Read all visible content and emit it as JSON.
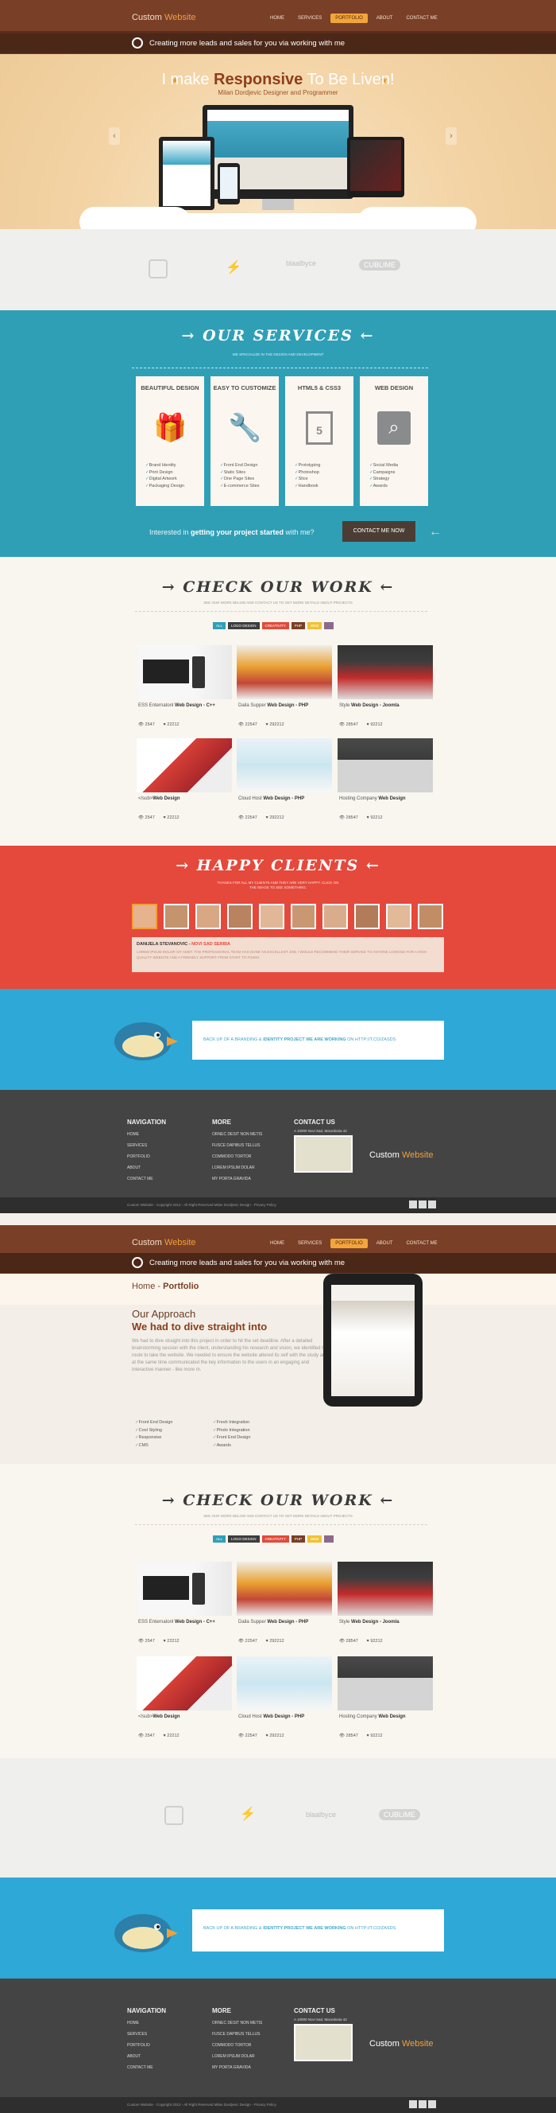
{
  "brand": {
    "name": "Custom ",
    "highlight": "Website"
  },
  "nav": [
    "HOME",
    "SERVICES",
    "PORTFOLIO",
    "ABOUT",
    "CONTACT ME"
  ],
  "strip": {
    "text": "Creating more leads and sales for you via working with me"
  },
  "hero": {
    "headline_pre": "I make ",
    "headline_bold": "Responsive",
    "headline_post": " To Be Liven!",
    "sub": "Milan Dordjevic Designer and Programmer"
  },
  "clients": [
    "blaalbyce",
    "CUBLIME"
  ],
  "services": {
    "title": "OUR SERVICES",
    "subtitle": "WE SPECIALIZE IN THE DESIGN AND DEVELOPMENT",
    "cards": [
      {
        "title": "BEAUTIFUL DESIGN",
        "icon": "gift-icon",
        "items": [
          "Brand Identity",
          "Print Design",
          "Digital Artwork",
          "Packaging Design"
        ]
      },
      {
        "title": "EASY TO CUSTOMIZE",
        "icon": "wrench-icon",
        "items": [
          "Front End Design",
          "Static Sites",
          "One Page Sites",
          "E-commerce Sites"
        ]
      },
      {
        "title": "HTML5 & CSS3",
        "icon": "html5-icon",
        "items": [
          "Prototyping",
          "Photoshop",
          "Slice",
          "Handbook"
        ]
      },
      {
        "title": "WEB DESIGN",
        "icon": "search-icon",
        "items": [
          "Social Media",
          "Campaigns",
          "Strategy",
          "Awards"
        ]
      }
    ],
    "cta_pre": "Interested in ",
    "cta_bold": "getting your project started",
    "cta_post": " with me?",
    "cta_btn": "CONTACT ME NOW"
  },
  "work": {
    "title": "CHECK OUR WORK",
    "subtitle": "SEE OUR WORK BELOW AND CONTACT US TO GET MORE DETAILS ABOUT PROJECTS",
    "filters": [
      "ALL",
      "LOGO DESIGN",
      "CREATIVITY",
      "PHP",
      "WEB"
    ],
    "items": [
      {
        "pre": "ESS Enternatonl ",
        "bold": "Web Design - C++",
        "views": "2547",
        "likes": "22212"
      },
      {
        "pre": "Daila Supper ",
        "bold": "Web Design - PHP",
        "views": "22547",
        "likes": "292212"
      },
      {
        "pre": "Style ",
        "bold": "Web Design - Joomla",
        "views": "28547",
        "likes": "92212"
      },
      {
        "pre": "</sub>",
        "bold": "Web Design",
        "views": "2547",
        "likes": "22212"
      },
      {
        "pre": "Cloud Host ",
        "bold": "Web Design - PHP",
        "views": "22547",
        "likes": "292212"
      },
      {
        "pre": "Hosting Company ",
        "bold": "Web Design",
        "views": "28547",
        "likes": "92212"
      }
    ]
  },
  "happy": {
    "title": "HAPPY CLIENTS",
    "subtitle": "THANKS FOR ALL MY CLIENTS AND THEY ARE VERY HAPPY. CLICK ON THE IMAGE TO SEE SOMETHING.",
    "quote_name": "DANIJELA STEVANOVIC",
    "quote_role": "NOVI SAD SERBIA",
    "quote_text": "LOREM IPSUM DOLOR SIT AMET. THE PROFESSIONAL TEAM HAS DONE AN EXCELLENT JOB. I WOULD RECOMMEND THEIR SERVICE TO ANYONE LOOKING FOR A HIGH QUALITY WEBSITE AND A FRIENDLY SUPPORT FROM START TO FINISH."
  },
  "bird": {
    "text_pre": "BACK UP OF A BRANDING & ",
    "text_bold": "IDENTITY PROJECT WE ARE WORKING",
    "text_post": " ON HTTP://T.CO/ZASDS"
  },
  "footer": {
    "nav_title": "NAVIGATION",
    "nav": [
      "HOME",
      "SERVICES",
      "PORTFOLIO",
      "ABOUT",
      "CONTACT ME"
    ],
    "more_title": "MORE",
    "more": [
      "ORNEC DESIT NON METIS",
      "FUSCE DAPIBUS TELLUS",
      "COMMODO TORTOR",
      "LOREM IPSUM DOLAR",
      "MY PORTA GRAVIDA"
    ],
    "contact_title": "CONTACT US",
    "address": "A 10000 Novi Sad, Macedonia 42",
    "copyright": "Custom Website - Copyright 2013 - All Right Reserved Milan Dordjevic Design - Privacy Policy"
  },
  "page2": {
    "breadcrumb_home": "Home",
    "breadcrumb_sep": " - ",
    "breadcrumb_current": "Portfolio",
    "approach_title": "Our Approach",
    "approach_bold": "We had to dive straight into",
    "approach_text": "We had to dive straight into this project in order to hit the set deadline. After a detailed brainstorming session with the client, understanding his research and vision, we identified the route to take the website. We needed to ensure the website altered its self with the study and at the same time communicated the key information to the users in an engaging and interactive manner - like more m.",
    "features_left": [
      "Front End Design",
      "Cool Styling",
      "Responsive",
      "CMS"
    ],
    "features_right": [
      "Fresh Integration",
      "Photo Integration",
      "Front End Design",
      "Awards"
    ]
  }
}
